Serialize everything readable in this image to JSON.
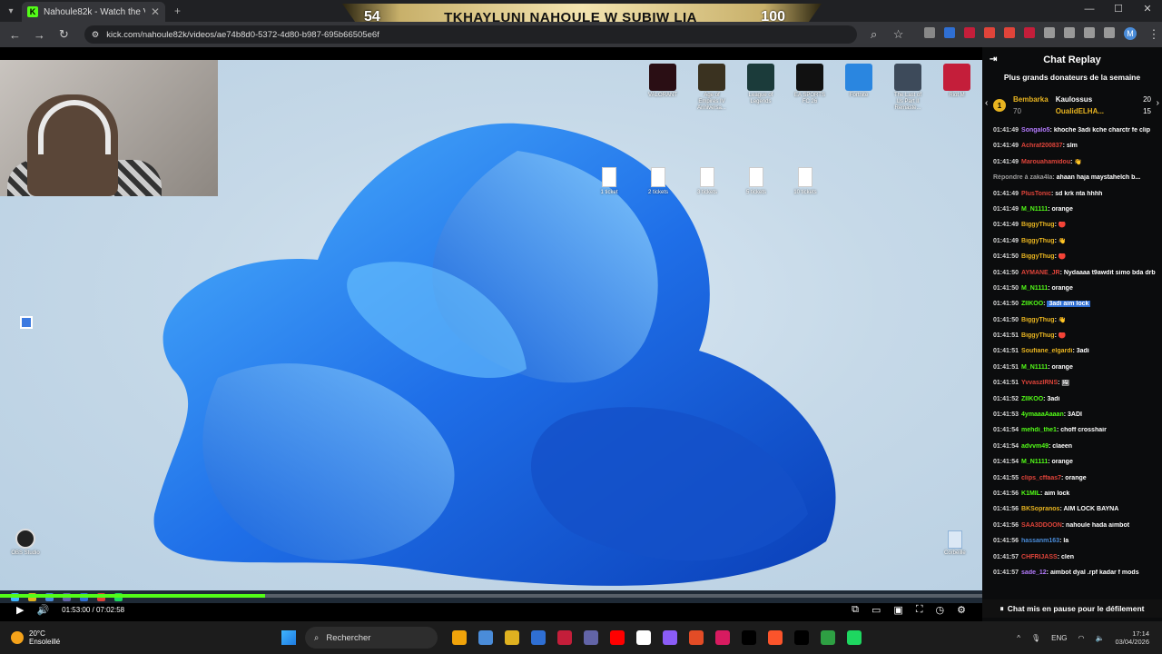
{
  "browser": {
    "tab_title": "Nahoule82k - Watch the VOD o",
    "url": "kick.com/nahoule82k/videos/ae74b8d0-5372-4d80-b987-695b66505e6f"
  },
  "banner": {
    "left_number": "54",
    "title": "TKHAYLUNI NAHOULE W SUBIW LIA",
    "right_number": "100"
  },
  "desktop": {
    "top_icons": [
      {
        "label": "VALORANT",
        "color": "#2a0e14"
      },
      {
        "label": "Age of Empires IV Anniversa...",
        "color": "#3a3220"
      },
      {
        "label": "League of Legends",
        "color": "#1b3b3a"
      },
      {
        "label": "EA SPORTS FC 26",
        "color": "#111111"
      },
      {
        "label": "Fortnite",
        "color": "#2a86e0"
      },
      {
        "label": "The Last of Us Part II Remaste...",
        "color": "#3d4a5a"
      },
      {
        "label": "Riot M",
        "color": "#c41e3a"
      }
    ],
    "files": [
      "1 ticket",
      "2 tickets",
      "3 tickets",
      "5 tickets",
      "10 tickets"
    ],
    "obs_label": "OBS Studio",
    "bin_label": "Corbeille"
  },
  "player": {
    "time": "01:53:00 / 07:02:58",
    "progress": 0.27
  },
  "chat": {
    "title": "Chat Replay",
    "donors_title": "Plus grands donateurs de la semaine",
    "donors": [
      {
        "rank": "1",
        "name": "Bembarka",
        "amount": "70"
      },
      {
        "name": "Kaulossus",
        "amount": "20"
      },
      {
        "name": "OualidELHA...",
        "amount": "15"
      }
    ],
    "messages": [
      {
        "time": "01:41:49",
        "user": "Songalo5",
        "color": "#b57cff",
        "text": "khoche 3adi kche charctr fe clip"
      },
      {
        "time": "01:41:49",
        "user": "Achraf200837",
        "color": "#e0443a",
        "text": "slm"
      },
      {
        "time": "01:41:49",
        "user": "Marouahamidou",
        "color": "#e0443a",
        "text": "👋"
      },
      {
        "time": "",
        "user": "Répondre à zaka4la:",
        "color": "#9a9a9a",
        "text": "ahaan haja maystahelch b..."
      },
      {
        "time": "01:41:49",
        "user": "PlusTonic",
        "color": "#e0443a",
        "text": "sd krk nta hhhh"
      },
      {
        "time": "01:41:49",
        "user": "M_N1111",
        "color": "#53fc18",
        "text": "orange"
      },
      {
        "time": "01:41:49",
        "user": "BiggyThug",
        "color": "#e8b420",
        "text": "🔴"
      },
      {
        "time": "01:41:49",
        "user": "BiggyThug",
        "color": "#e8b420",
        "text": "👋"
      },
      {
        "time": "01:41:50",
        "user": "BiggyThug",
        "color": "#e8b420",
        "text": "🔴"
      },
      {
        "time": "01:41:50",
        "user": "AYMANE_JR",
        "color": "#e0443a",
        "text": "Nydaaaa t9awdit simo bda drb simo"
      },
      {
        "time": "01:41:50",
        "user": "M_N1111",
        "color": "#53fc18",
        "text": "orange"
      },
      {
        "time": "01:41:50",
        "user": "ZIIKOO",
        "color": "#53fc18",
        "text": "3adi aim lock"
      },
      {
        "time": "01:41:50",
        "user": "BiggyThug",
        "color": "#e8b420",
        "text": "👋"
      },
      {
        "time": "01:41:51",
        "user": "BiggyThug",
        "color": "#e8b420",
        "text": "🔴"
      },
      {
        "time": "01:41:51",
        "user": "Soufiane_elgardi",
        "color": "#e8b420",
        "text": "3adi"
      },
      {
        "time": "01:41:51",
        "user": "M_N1111",
        "color": "#53fc18",
        "text": "orange"
      },
      {
        "time": "01:41:51",
        "user": "YvvaszIRNS",
        "color": "#e0443a",
        "text": "🖼"
      },
      {
        "time": "01:41:52",
        "user": "ZIIKOO",
        "color": "#53fc18",
        "text": "3adi"
      },
      {
        "time": "01:41:53",
        "user": "4ymaaaAaaan",
        "color": "#53fc18",
        "text": "3ADI"
      },
      {
        "time": "01:41:54",
        "user": "mehdi_the1",
        "color": "#53fc18",
        "text": "choff crosshair"
      },
      {
        "time": "01:41:54",
        "user": "advvm49",
        "color": "#53fc18",
        "text": "claeen"
      },
      {
        "time": "01:41:54",
        "user": "M_N1111",
        "color": "#53fc18",
        "text": "orange"
      },
      {
        "time": "01:41:55",
        "user": "clips_cffaas7",
        "color": "#e0443a",
        "text": "orange"
      },
      {
        "time": "01:41:56",
        "user": "K1MIL",
        "color": "#53fc18",
        "text": "aim lock"
      },
      {
        "time": "01:41:56",
        "user": "BKSopranos",
        "color": "#e8b420",
        "text": "AIM LOCK BAYNA"
      },
      {
        "time": "01:41:56",
        "user": "SAA3DDOON",
        "color": "#e0443a",
        "text": "nahoule hada aimbot"
      },
      {
        "time": "01:41:56",
        "user": "hassanm163",
        "color": "#4a8cd9",
        "text": "la"
      },
      {
        "time": "01:41:57",
        "user": "CHFRIJASS",
        "color": "#e0443a",
        "text": "clen"
      },
      {
        "time": "01:41:57",
        "user": "sade_12",
        "color": "#b57cff",
        "text": "aimbot dyal .rpf kadar f mods"
      },
      {
        "time": "01:41:57",
        "user": "sade_12",
        "color": "#b57cff",
        "text": "aimbot dyal .rpf kadar f mods"
      }
    ],
    "paused": "Chat mis en pause pour le défilement"
  },
  "taskbar": {
    "temp": "20°C",
    "weather": "Ensoleillé",
    "search": "Rechercher",
    "apps": [
      "#f0a30a",
      "#4a8cd9",
      "#dfb120",
      "#2f6fd3",
      "#c41e3a",
      "#6264a7",
      "#ff0000",
      "#ffffff",
      "#8b5cf6",
      "#e34c26",
      "#d81b60",
      "#000000",
      "#fb542b",
      "#000000",
      "#2ea043",
      "#1ed760"
    ],
    "lang": "ENG",
    "time": "17:14",
    "date": "03/04/2026"
  }
}
